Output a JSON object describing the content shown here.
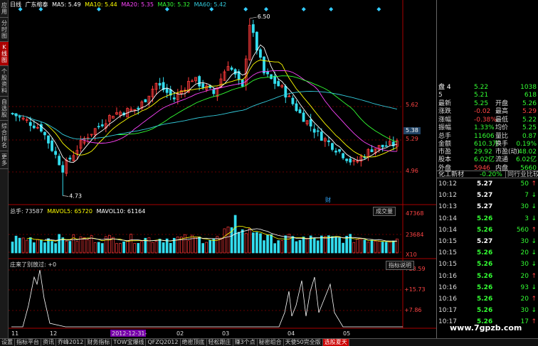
{
  "sidebar": [
    "应用",
    "分时图",
    "K线图",
    "个股资料",
    "自选股",
    "综合排名",
    "更多"
  ],
  "mabar": {
    "period": "日线",
    "name": "广东榕泰",
    "ma5": "MA5: 5.49",
    "ma10": "MA10: 5.44",
    "ma20": "MA20: 5.35",
    "ma30": "MA30: 5.32",
    "ma60": "MA60: 5.42"
  },
  "price_axis": [
    "5.62",
    "5.38",
    "5.29",
    "4.96"
  ],
  "price_marks": {
    "high": "6.50",
    "low": "4.73"
  },
  "vol_hdr": {
    "a": "总手: 73587",
    "b": "MAVOL5: 65720",
    "c": "MAVOL10: 61164"
  },
  "vol_axis": [
    "47368",
    "23684",
    "X10"
  ],
  "vol_btn": "成交量",
  "cai": "财",
  "ind3": {
    "hdr": "庄来了别放过: +0",
    "btn": "指标说明",
    "axis": [
      "+23.59",
      "+15.73",
      "+7.86"
    ]
  },
  "dates": [
    "11",
    "12",
    "2012-12-31-",
    "02",
    "03",
    "04",
    "05"
  ],
  "quote": [
    {
      "a": "盘 4",
      "b": "5.22",
      "c": "",
      "d": "1038"
    },
    {
      "a": "5",
      "b": "5.21",
      "c": "",
      "d": "618"
    },
    {
      "a": "最新",
      "b": "5.25",
      "c": "开盘",
      "d": "5.26"
    },
    {
      "a": "涨跌",
      "b": "-0.02",
      "c": "最高",
      "d": "5.29"
    },
    {
      "a": "涨幅",
      "b": "-0.38%",
      "c": "最低",
      "d": "5.22"
    },
    {
      "a": "振幅",
      "b": "1.33%",
      "c": "均价",
      "d": "5.25"
    },
    {
      "a": "总手",
      "b": "11606",
      "c": "量比",
      "d": "0.87"
    },
    {
      "a": "金额",
      "b": "610.3万",
      "c": "换手",
      "d": "0.19%"
    },
    {
      "a": "市盈",
      "b": "29.92",
      "c": "市盈(动)",
      "d": "48.02"
    },
    {
      "a": "股本",
      "b": "6.02亿",
      "c": "流通",
      "d": "6.02亿"
    },
    {
      "a": "外盘",
      "b": "5946",
      "c": "内盘",
      "d": "5660"
    }
  ],
  "industry": {
    "name": "化工新材",
    "pct": "-0.20%",
    "btn": "同行业比较"
  },
  "ticks": [
    [
      "10:12",
      "5.27",
      "50",
      "up"
    ],
    [
      "10:12",
      "5.27",
      "7",
      "dn"
    ],
    [
      "10:13",
      "5.27",
      "30",
      "dn"
    ],
    [
      "10:14",
      "5.26",
      "3",
      "dn"
    ],
    [
      "10:14",
      "5.26",
      "560",
      "up"
    ],
    [
      "10:15",
      "5.27",
      "30",
      "dn"
    ],
    [
      "10:15",
      "5.26",
      "20",
      "dn"
    ],
    [
      "10:15",
      "5.26",
      "30",
      "dn"
    ],
    [
      "10:16",
      "5.26",
      "20",
      "up"
    ],
    [
      "10:16",
      "5.26",
      "93",
      "dn"
    ],
    [
      "10:16",
      "5.26",
      "20",
      "up"
    ],
    [
      "10:17",
      "5.26",
      "30",
      "dn"
    ],
    [
      "10:17",
      "5.26",
      "17",
      "up"
    ]
  ],
  "tabs": [
    "设置",
    "指标平台",
    "资讯",
    "乔峰2012",
    "财务指标",
    "TOW宝爆线",
    "QFZQ2012",
    "绝密顶底",
    "轻松跟庄",
    "赚3个点",
    "秘密组合",
    "天使50完全版",
    "选股夏天"
  ],
  "watermark": "www.7gpzb.com",
  "colors": {
    "up": "#ff3b3b",
    "down": "#33ddee",
    "ma5": "#ffffff",
    "ma10": "#ffff00",
    "ma20": "#ff44ff",
    "ma30": "#33ff33",
    "ma60": "#33ccdd"
  }
}
